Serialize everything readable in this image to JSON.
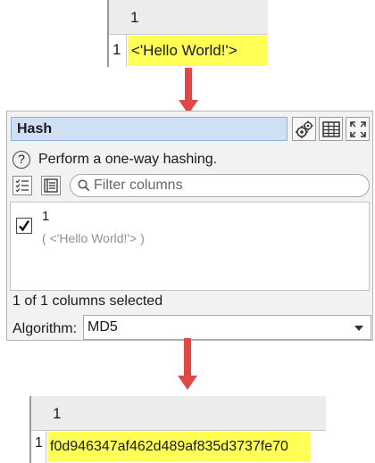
{
  "input_table": {
    "column_header": "1",
    "row_number": "1",
    "cell_value": "<'Hello World!'>"
  },
  "panel": {
    "title": "Hash",
    "description": "Perform a one-way hashing.",
    "filter_placeholder": "Filter columns",
    "columns": [
      {
        "name": "1",
        "sample": "( <'Hello World!'> )",
        "checked": true
      }
    ],
    "selection_count": "1 of 1 columns selected",
    "algorithm_label": "Algorithm:",
    "algorithm_value": "MD5",
    "icons": [
      "gears-icon",
      "table-icon",
      "expand-icon",
      "help-icon",
      "select-all-icon",
      "column-list-icon",
      "search-icon"
    ]
  },
  "output_table": {
    "column_header": "1",
    "row_number": "1",
    "cell_value": "f0d946347af462d489af835d3737fe70"
  },
  "colors": {
    "highlight": "#ffff55",
    "arrow": "#e04848",
    "title_bg": "#cfe0f4"
  }
}
